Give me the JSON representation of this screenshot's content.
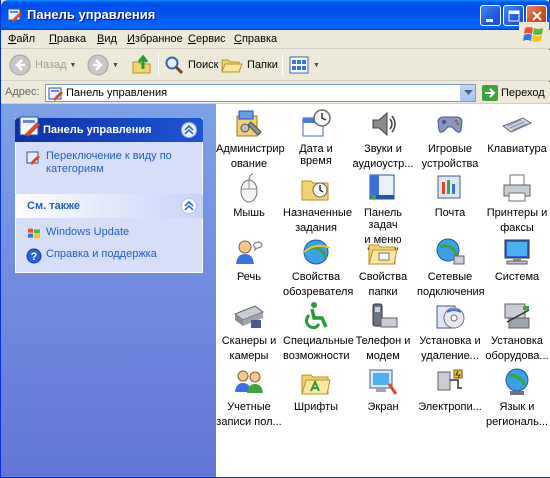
{
  "window": {
    "title": "Панель управления"
  },
  "menubar": {
    "items": [
      "Файл",
      "Правка",
      "Вид",
      "Избранное",
      "Сервис",
      "Справка"
    ]
  },
  "toolbar": {
    "back_label": "Назад",
    "search_label": "Поиск",
    "folders_label": "Папки"
  },
  "address": {
    "label": "Адрес:",
    "value": "Панель управления",
    "go_label": "Переход"
  },
  "left_panel": {
    "main": {
      "title": "Панель управления",
      "link": "Переключение к виду по категориям"
    },
    "see_also": {
      "title": "См. также",
      "links": [
        "Windows Update",
        "Справка и поддержка"
      ]
    }
  },
  "items": [
    {
      "label": "Администрирование",
      "line1": "Администрир",
      "line2": "ование",
      "icon": "admin-tools-icon"
    },
    {
      "label": "Дата и время",
      "line1": "Дата и время",
      "line2": "",
      "icon": "date-time-icon"
    },
    {
      "label": "Звуки и аудиоустр...",
      "line1": "Звуки и",
      "line2": "аудиоустр...",
      "icon": "sounds-icon"
    },
    {
      "label": "Игровые устройства",
      "line1": "Игровые",
      "line2": "устройства",
      "icon": "game-controller-icon"
    },
    {
      "label": "Клавиатура",
      "line1": "Клавиатура",
      "line2": "",
      "icon": "keyboard-icon"
    },
    {
      "label": "Мышь",
      "line1": "Мышь",
      "line2": "",
      "icon": "mouse-icon"
    },
    {
      "label": "Назначенные задания",
      "line1": "Назначенные",
      "line2": "задания",
      "icon": "scheduled-tasks-icon"
    },
    {
      "label": "Панель задач и меню \"Пуск\"",
      "line1": "Панель задач",
      "line2": "и меню \"Пуск\"",
      "icon": "taskbar-icon"
    },
    {
      "label": "Почта",
      "line1": "Почта",
      "line2": "",
      "icon": "mail-icon"
    },
    {
      "label": "Принтеры и факсы",
      "line1": "Принтеры и",
      "line2": "факсы",
      "icon": "printer-icon"
    },
    {
      "label": "Речь",
      "line1": "Речь",
      "line2": "",
      "icon": "speech-icon"
    },
    {
      "label": "Свойства обозревателя",
      "line1": "Свойства",
      "line2": "обозревателя",
      "icon": "internet-options-icon"
    },
    {
      "label": "Свойства папки",
      "line1": "Свойства",
      "line2": "папки",
      "icon": "folder-options-icon"
    },
    {
      "label": "Сетевые подключения",
      "line1": "Сетевые",
      "line2": "подключения",
      "icon": "network-icon"
    },
    {
      "label": "Система",
      "line1": "Система",
      "line2": "",
      "icon": "system-icon"
    },
    {
      "label": "Сканеры и камеры",
      "line1": "Сканеры и",
      "line2": "камеры",
      "icon": "scanner-icon"
    },
    {
      "label": "Специальные возможности",
      "line1": "Специальные",
      "line2": "возможности",
      "icon": "accessibility-icon"
    },
    {
      "label": "Телефон и модем",
      "line1": "Телефон и",
      "line2": "модем",
      "icon": "phone-modem-icon"
    },
    {
      "label": "Установка и удаление...",
      "line1": "Установка и",
      "line2": "удаление...",
      "icon": "add-remove-programs-icon"
    },
    {
      "label": "Установка оборудова...",
      "line1": "Установка",
      "line2": "оборудова...",
      "icon": "add-hardware-icon"
    },
    {
      "label": "Учетные записи пол...",
      "line1": "Учетные",
      "line2": "записи пол...",
      "icon": "user-accounts-icon"
    },
    {
      "label": "Шрифты",
      "line1": "Шрифты",
      "line2": "",
      "icon": "fonts-icon"
    },
    {
      "label": "Экран",
      "line1": "Экран",
      "line2": "",
      "icon": "display-icon"
    },
    {
      "label": "Электропи...",
      "line1": "Электропи...",
      "line2": "",
      "icon": "power-options-icon"
    },
    {
      "label": "Язык и региональ...",
      "line1": "Язык и",
      "line2": "региональ...",
      "icon": "regional-options-icon"
    }
  ]
}
